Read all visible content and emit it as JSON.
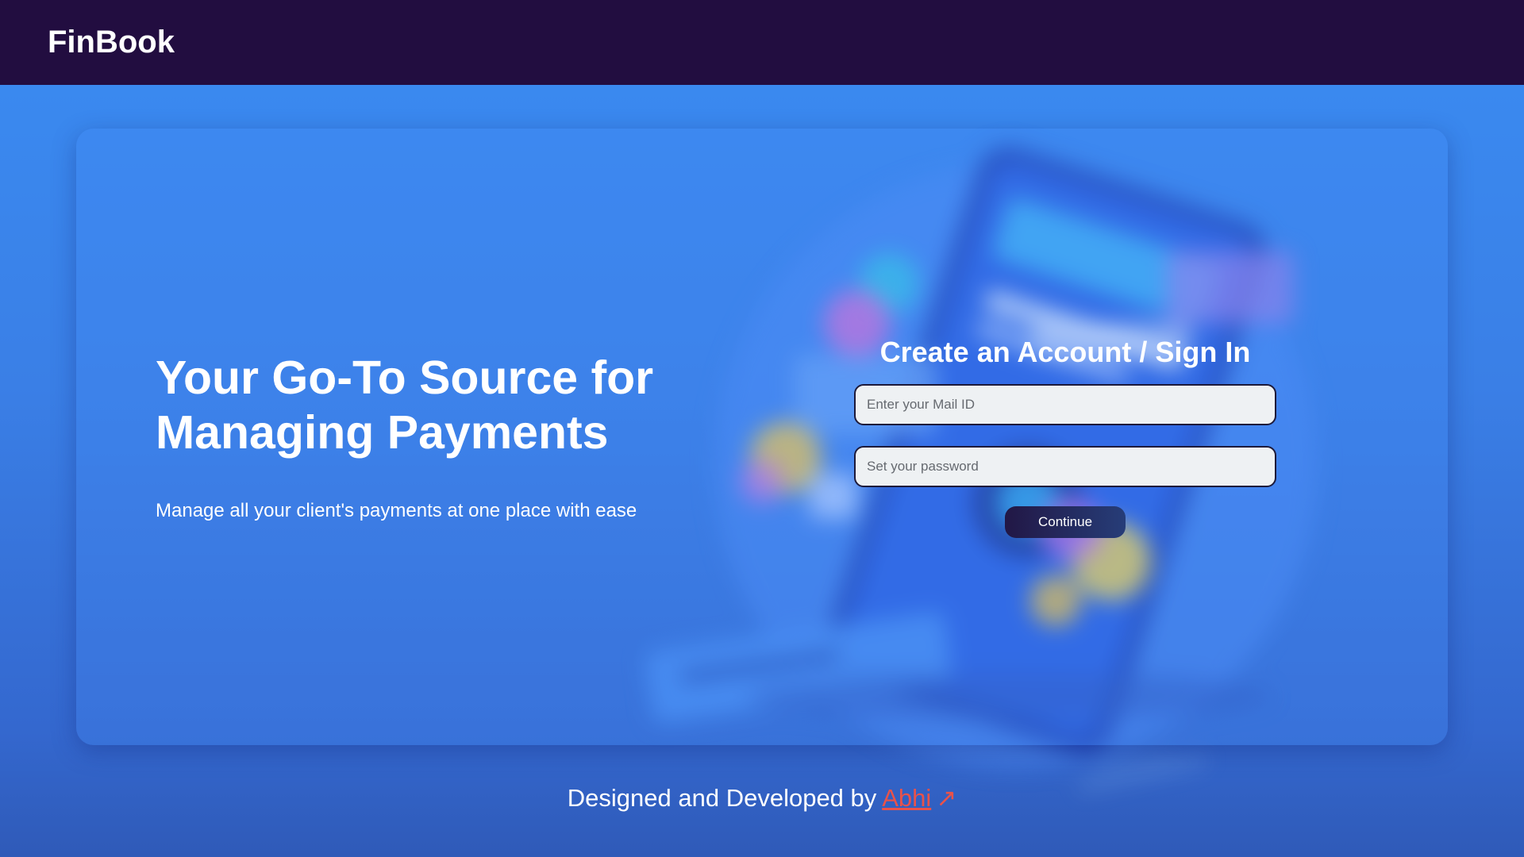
{
  "navbar": {
    "brand": "FinBook"
  },
  "hero": {
    "headline": "Your Go-To Source for Managing Payments",
    "subline": "Manage all your client's payments at one place with ease"
  },
  "form": {
    "title": "Create an Account / Sign In",
    "email_placeholder": "Enter your Mail ID",
    "password_placeholder": "Set your password",
    "continue_label": "Continue"
  },
  "footer": {
    "prefix": "Designed and Developed by",
    "author_link": "Abhi",
    "arrow_icon": "↗"
  },
  "colors": {
    "navbar_bg": "#220d40",
    "page_bg": "#3a7fe6",
    "link": "#e8524a"
  }
}
